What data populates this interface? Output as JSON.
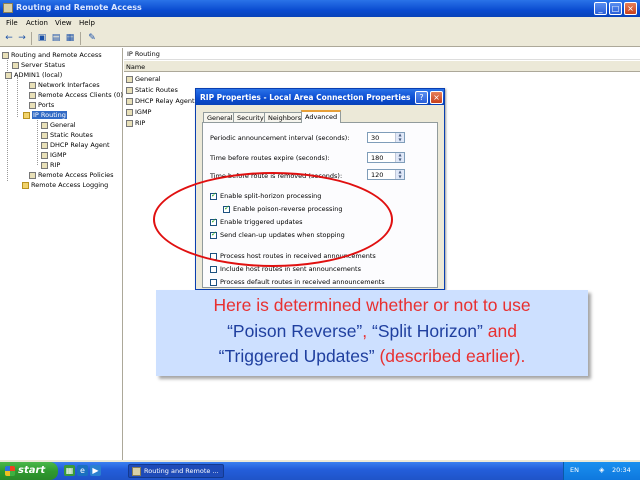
{
  "window": {
    "title": "Routing and Remote Access"
  },
  "menu": [
    "File",
    "Action",
    "View",
    "Help"
  ],
  "tree": [
    {
      "label": "Routing and Remote Access"
    },
    {
      "label": "Server Status"
    },
    {
      "label": "ADMIN1 (local)"
    },
    {
      "label": "Network Interfaces"
    },
    {
      "label": "Remote Access Clients (0)"
    },
    {
      "label": "Ports"
    },
    {
      "label": "IP Routing"
    },
    {
      "label": "General"
    },
    {
      "label": "Static Routes"
    },
    {
      "label": "DHCP Relay Agent"
    },
    {
      "label": "IGMP"
    },
    {
      "label": "RIP"
    },
    {
      "label": "Remote Access Policies"
    },
    {
      "label": "Remote Access Logging"
    }
  ],
  "right_pane": {
    "header": "IP Routing",
    "column": "Name",
    "items": [
      "General",
      "Static Routes",
      "DHCP Relay Agent",
      "IGMP",
      "RIP"
    ]
  },
  "dialog": {
    "title": "RIP Properties - Local Area Connection Properties",
    "help_glyph": "?",
    "close_glyph": "×",
    "tabs": [
      "General",
      "Security",
      "Neighbors",
      "Advanced"
    ],
    "fields": [
      {
        "label": "Periodic announcement interval (seconds):",
        "value": "30"
      },
      {
        "label": "Time before routes expire (seconds):",
        "value": "180"
      },
      {
        "label": "Time before route is removed (seconds):",
        "value": "120"
      }
    ],
    "checkboxes": [
      {
        "label": "Enable split-horizon processing",
        "checked": true
      },
      {
        "label": "Enable poison-reverse processing",
        "checked": true
      },
      {
        "label": "Enable triggered updates",
        "checked": true
      },
      {
        "label": "Send clean-up updates when stopping",
        "checked": true
      },
      {
        "label": "Process host routes in received announcements",
        "checked": false
      },
      {
        "label": "Include host routes in sent announcements",
        "checked": false
      },
      {
        "label": "Process default routes in received announcements",
        "checked": false
      }
    ]
  },
  "caption": {
    "line1": "Here is determined whether or not to use",
    "poison": "“Poison Reverse”",
    "comma1": ", ",
    "split": "“Split Horizon”",
    "and": " and",
    "triggered": "“Triggered Updates”",
    "tail": " (described earlier)."
  },
  "taskbar": {
    "start_label": "start",
    "task_label": "Routing and Remote ...",
    "language": "EN",
    "clock": "20:34"
  },
  "colors": {
    "caption_bg": "#cde0ff",
    "caption_red": "#e83030",
    "caption_blue": "#1f3f9f",
    "ellipse": "#e01010"
  }
}
